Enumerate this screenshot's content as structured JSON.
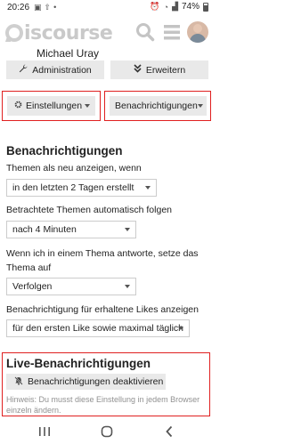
{
  "status": {
    "time": "20:26",
    "battery": "74%"
  },
  "header": {
    "logo_text": "iscourse"
  },
  "user": {
    "name": "Michael Uray"
  },
  "actions": {
    "admin_label": "Administration",
    "expand_label": "Erweitern"
  },
  "tabs": {
    "settings_label": "Einstellungen",
    "notifications_label": "Benachrichtigungen"
  },
  "notifications": {
    "heading": "Benachrichtigungen",
    "show_new_label": "Themen als neu anzeigen, wenn",
    "show_new_value": "in den letzten 2 Tagen erstellt",
    "auto_track_label": "Betrachtete Themen automatisch folgen",
    "auto_track_value": "nach 4 Minuten",
    "reply_label_line1": "Wenn ich in einem Thema antworte, setze das",
    "reply_label_line2": "Thema auf",
    "reply_value": "Verfolgen",
    "likes_label": "Benachrichtigung für erhaltene Likes anzeigen",
    "likes_value": "für den ersten Like sowie maximal täglich"
  },
  "live": {
    "heading": "Live-Benachrichtigungen",
    "button_label": "Benachrichtigungen deaktivieren",
    "hint_line1": "Hinweis: Du musst diese Einstellung in jedem Browser",
    "hint_line2": "einzeln ändern."
  }
}
